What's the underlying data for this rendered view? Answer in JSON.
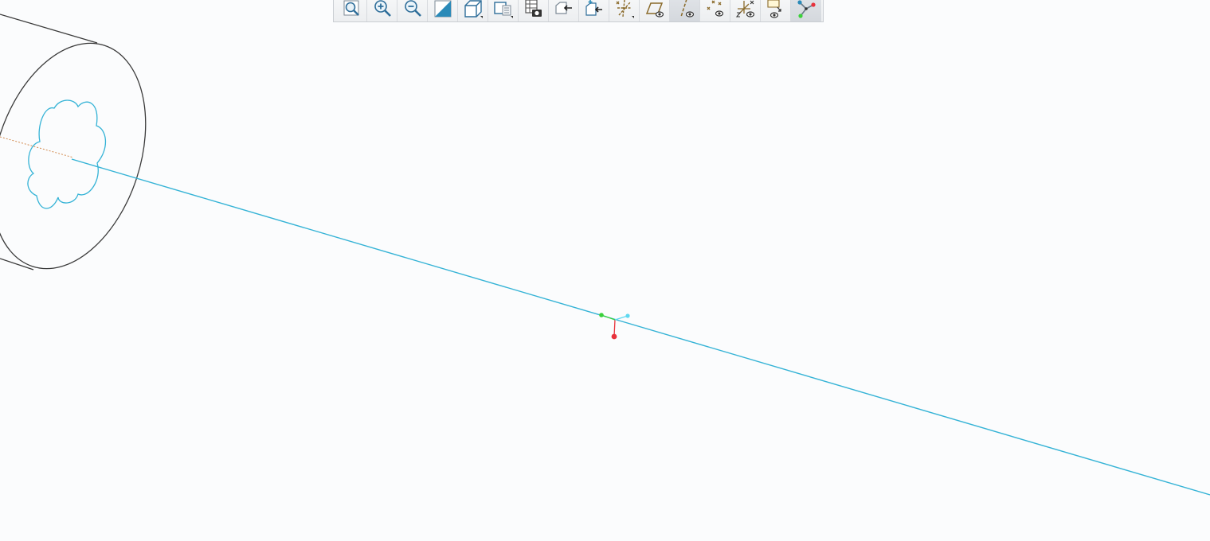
{
  "viewport": {
    "background": "#fbfcfd",
    "colors": {
      "geometry_edge": "#3a3a3a",
      "sketch": "#35b3d6",
      "datum_axis": "#d28a4e",
      "triad_x": "#e8323c",
      "triad_y": "#3ad13a",
      "triad_z": "#5fd8f0"
    }
  },
  "toolbar": {
    "buttons": [
      {
        "id": "refit",
        "icon": "refit-icon",
        "active": false
      },
      {
        "id": "zoom-in",
        "icon": "zoom-in-icon",
        "active": false
      },
      {
        "id": "zoom-out",
        "icon": "zoom-out-icon",
        "active": false
      },
      {
        "id": "repaint",
        "icon": "repaint-icon",
        "active": false
      },
      {
        "id": "display-style",
        "icon": "display-style-icon",
        "active": false
      },
      {
        "id": "saved-orientations",
        "icon": "saved-orientations-icon",
        "active": false
      },
      {
        "id": "view-manager",
        "icon": "view-manager-icon",
        "active": false
      },
      {
        "id": "section-1",
        "icon": "section-icon",
        "active": false
      },
      {
        "id": "section-2",
        "icon": "section-add-icon",
        "active": false
      },
      {
        "id": "datum-display",
        "icon": "datum-display-filters-icon",
        "active": false
      },
      {
        "id": "plane-display",
        "icon": "plane-display-icon",
        "active": false
      },
      {
        "id": "axis-display",
        "icon": "axis-display-icon",
        "active": true
      },
      {
        "id": "point-display",
        "icon": "point-display-icon",
        "active": false
      },
      {
        "id": "csys-display",
        "icon": "csys-display-icon",
        "active": false
      },
      {
        "id": "annotation-display",
        "icon": "annotation-display-icon",
        "active": false
      },
      {
        "id": "spin-center",
        "icon": "spin-center-icon",
        "active": true
      }
    ]
  }
}
